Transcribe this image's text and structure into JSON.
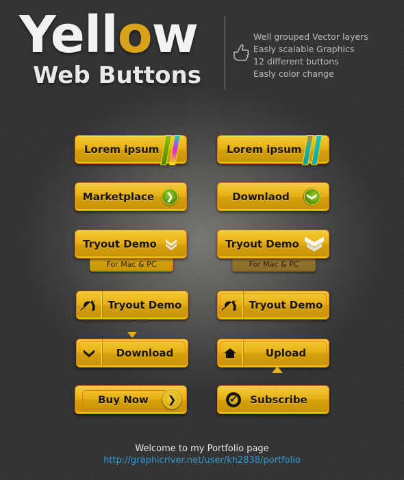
{
  "header": {
    "title_part1": "Yell",
    "title_o": "o",
    "title_part2": "w",
    "subtitle": "Web Buttons",
    "features": [
      "Well grouped Vector layers",
      "Easly scalable Graphics",
      "12  different buttons",
      "Easly color change"
    ],
    "feature_icon": "thumbs-up-icon"
  },
  "buttons": {
    "lorem1": {
      "label": "Lorem ipsum",
      "icon": "color-stripes-icon"
    },
    "lorem2": {
      "label": "Lorem ipsum",
      "icon": "teal-stripes-icon"
    },
    "marketplace": {
      "label": "Marketplace",
      "icon": "chevron-right-icon",
      "glyph": "❯"
    },
    "downlaod": {
      "label": "Downlaod",
      "icon": "chevron-down-icon",
      "glyph": "❯"
    },
    "tryout1": {
      "label": "Tryout Demo",
      "sub": "For Mac & PC",
      "icon": "double-chevron-down-icon"
    },
    "tryout2": {
      "label": "Tryout Demo",
      "sub": "For Mac & PC",
      "icon": "double-chevron-down-icon"
    },
    "tryout3": {
      "label": "Tryout Demo",
      "icon": "snail-icon"
    },
    "tryout4": {
      "label": "Tryout Demo",
      "icon": "snail-icon"
    },
    "download": {
      "label": "Download",
      "icon": "chevron-down-icon"
    },
    "upload": {
      "label": "Upload",
      "icon": "home-icon"
    },
    "buynow": {
      "label": "Buy Now",
      "icon": "chevron-right-icon",
      "glyph": "❯"
    },
    "subscribe": {
      "label": "Subscribe",
      "icon": "checkmark-circle-icon",
      "glyph": "✔"
    }
  },
  "colors": {
    "button_yellow": "#e7b116",
    "button_border": "#e07a10",
    "accent_green": "#5f9a10",
    "link_blue": "#2f9bd4"
  },
  "footer": {
    "welcome": "Welcome to my Portfolio page",
    "link": "http://graphicriver.net/user/kh2838/portfolio"
  }
}
